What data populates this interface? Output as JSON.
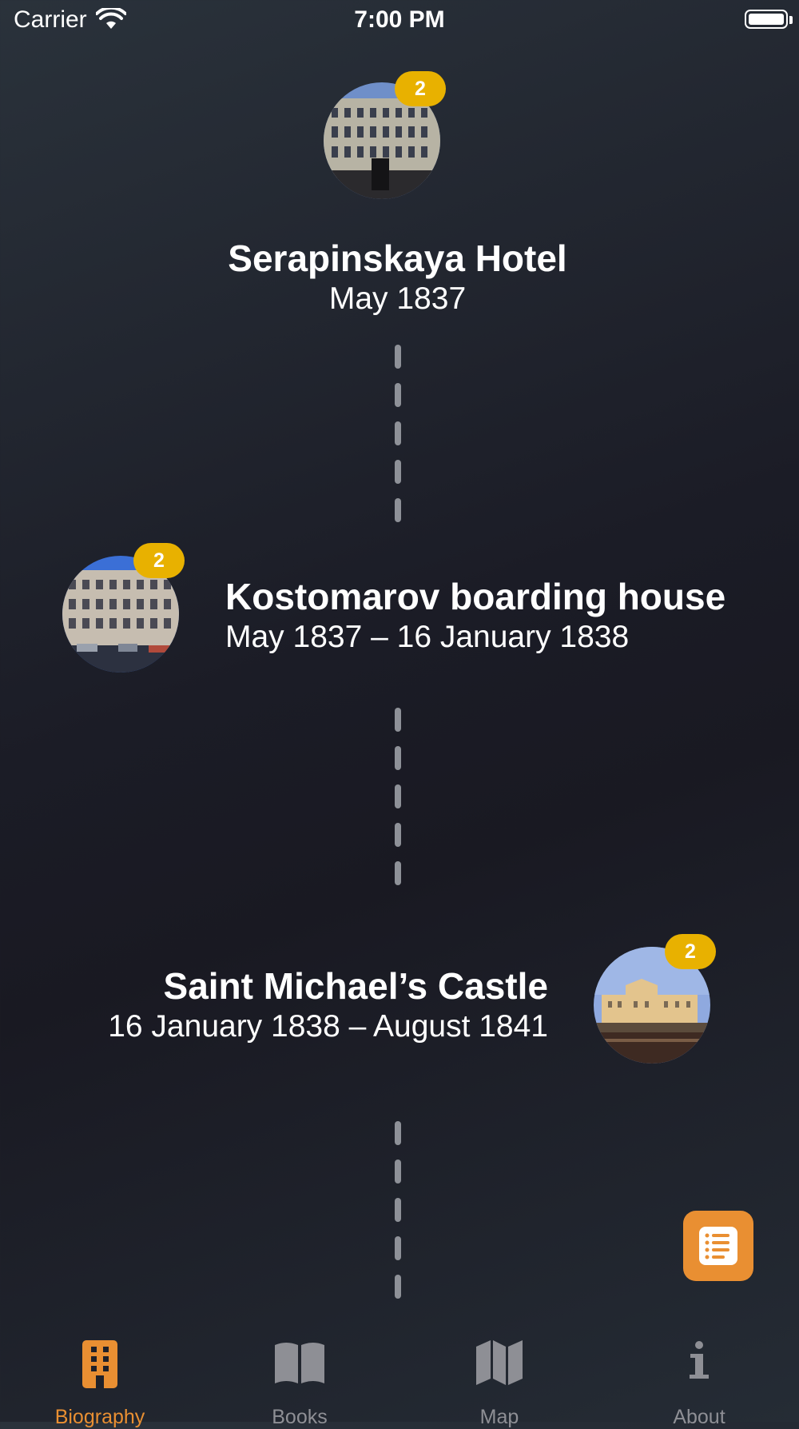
{
  "status_bar": {
    "carrier": "Carrier",
    "time": "7:00 PM"
  },
  "timeline": [
    {
      "title": "Serapinskaya Hotel",
      "dates": "May 1837",
      "badge": "2"
    },
    {
      "title": "Kostomarov boarding house",
      "dates": "May 1837 – 16 January 1838",
      "badge": "2"
    },
    {
      "title": "Saint Michael’s Castle",
      "dates": "16 January 1838 – August 1841",
      "badge": "2"
    }
  ],
  "tabs": [
    {
      "label": "Biography",
      "icon": "building-icon",
      "active": true
    },
    {
      "label": "Books",
      "icon": "book-icon",
      "active": false
    },
    {
      "label": "Map",
      "icon": "map-icon",
      "active": false
    },
    {
      "label": "About",
      "icon": "info-icon",
      "active": false
    }
  ],
  "colors": {
    "accent": "#e98f32",
    "badge": "#e8b100",
    "dash": "#8e9198",
    "inactive": "#8e8f95"
  }
}
